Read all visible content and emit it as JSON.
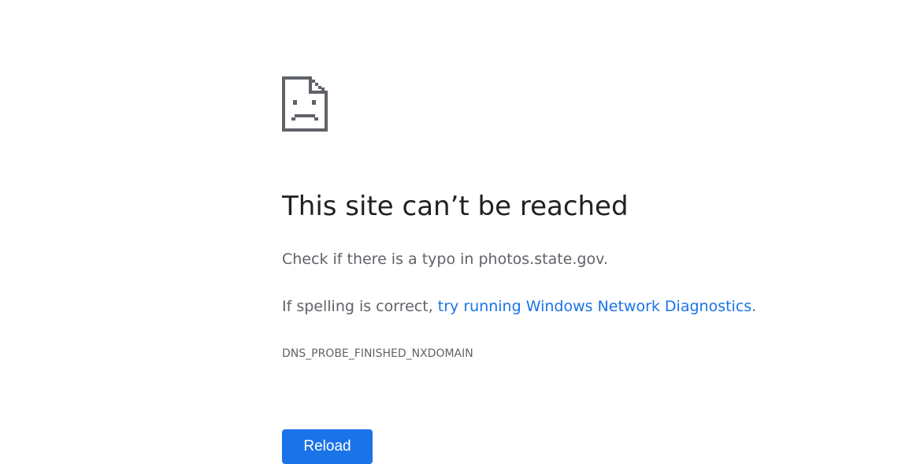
{
  "error": {
    "icon": "sad-page-icon",
    "title": "This site can’t be reached",
    "typo_text": "Check if there is a typo in photos.state.gov.",
    "diag_prefix": "If spelling is correct, ",
    "diag_link": "try running Windows Network Diagnostics",
    "diag_suffix": ".",
    "code": "DNS_PROBE_FINISHED_NXDOMAIN"
  },
  "actions": {
    "reload_label": "Reload"
  },
  "colors": {
    "link": "#1a73e8",
    "button": "#1a73e8",
    "title": "#202124",
    "body_text": "#5f6368",
    "icon": "#5f6368"
  }
}
